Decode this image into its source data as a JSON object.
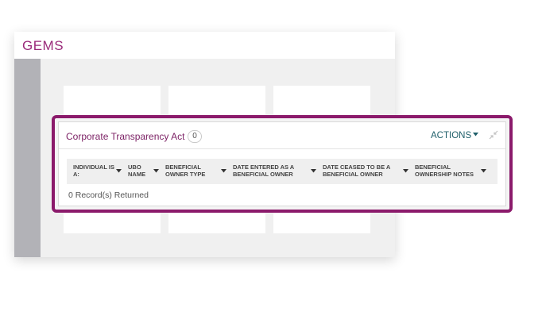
{
  "app": {
    "logo_text": "GEMS",
    "brand_color": "#9a2a7a",
    "highlight_color": "#8b1a6b"
  },
  "widget": {
    "title": "Corporate Transparency Act",
    "count": "0",
    "actions_label": "ACTIONS",
    "actions_icon": "caret-down-icon",
    "collapse_icon": "collapse-arrows-icon",
    "columns": [
      {
        "label": "INDIVIDUAL IS A:"
      },
      {
        "label": "UBO NAME"
      },
      {
        "label": "BENEFICIAL OWNER TYPE"
      },
      {
        "label": "DATE ENTERED AS A BENEFICIAL OWNER"
      },
      {
        "label": "DATE CEASED TO BE A BENEFICIAL OWNER"
      },
      {
        "label": "BENEFICIAL OWNERSHIP NOTES"
      }
    ],
    "records_text": "0 Record(s) Returned"
  }
}
